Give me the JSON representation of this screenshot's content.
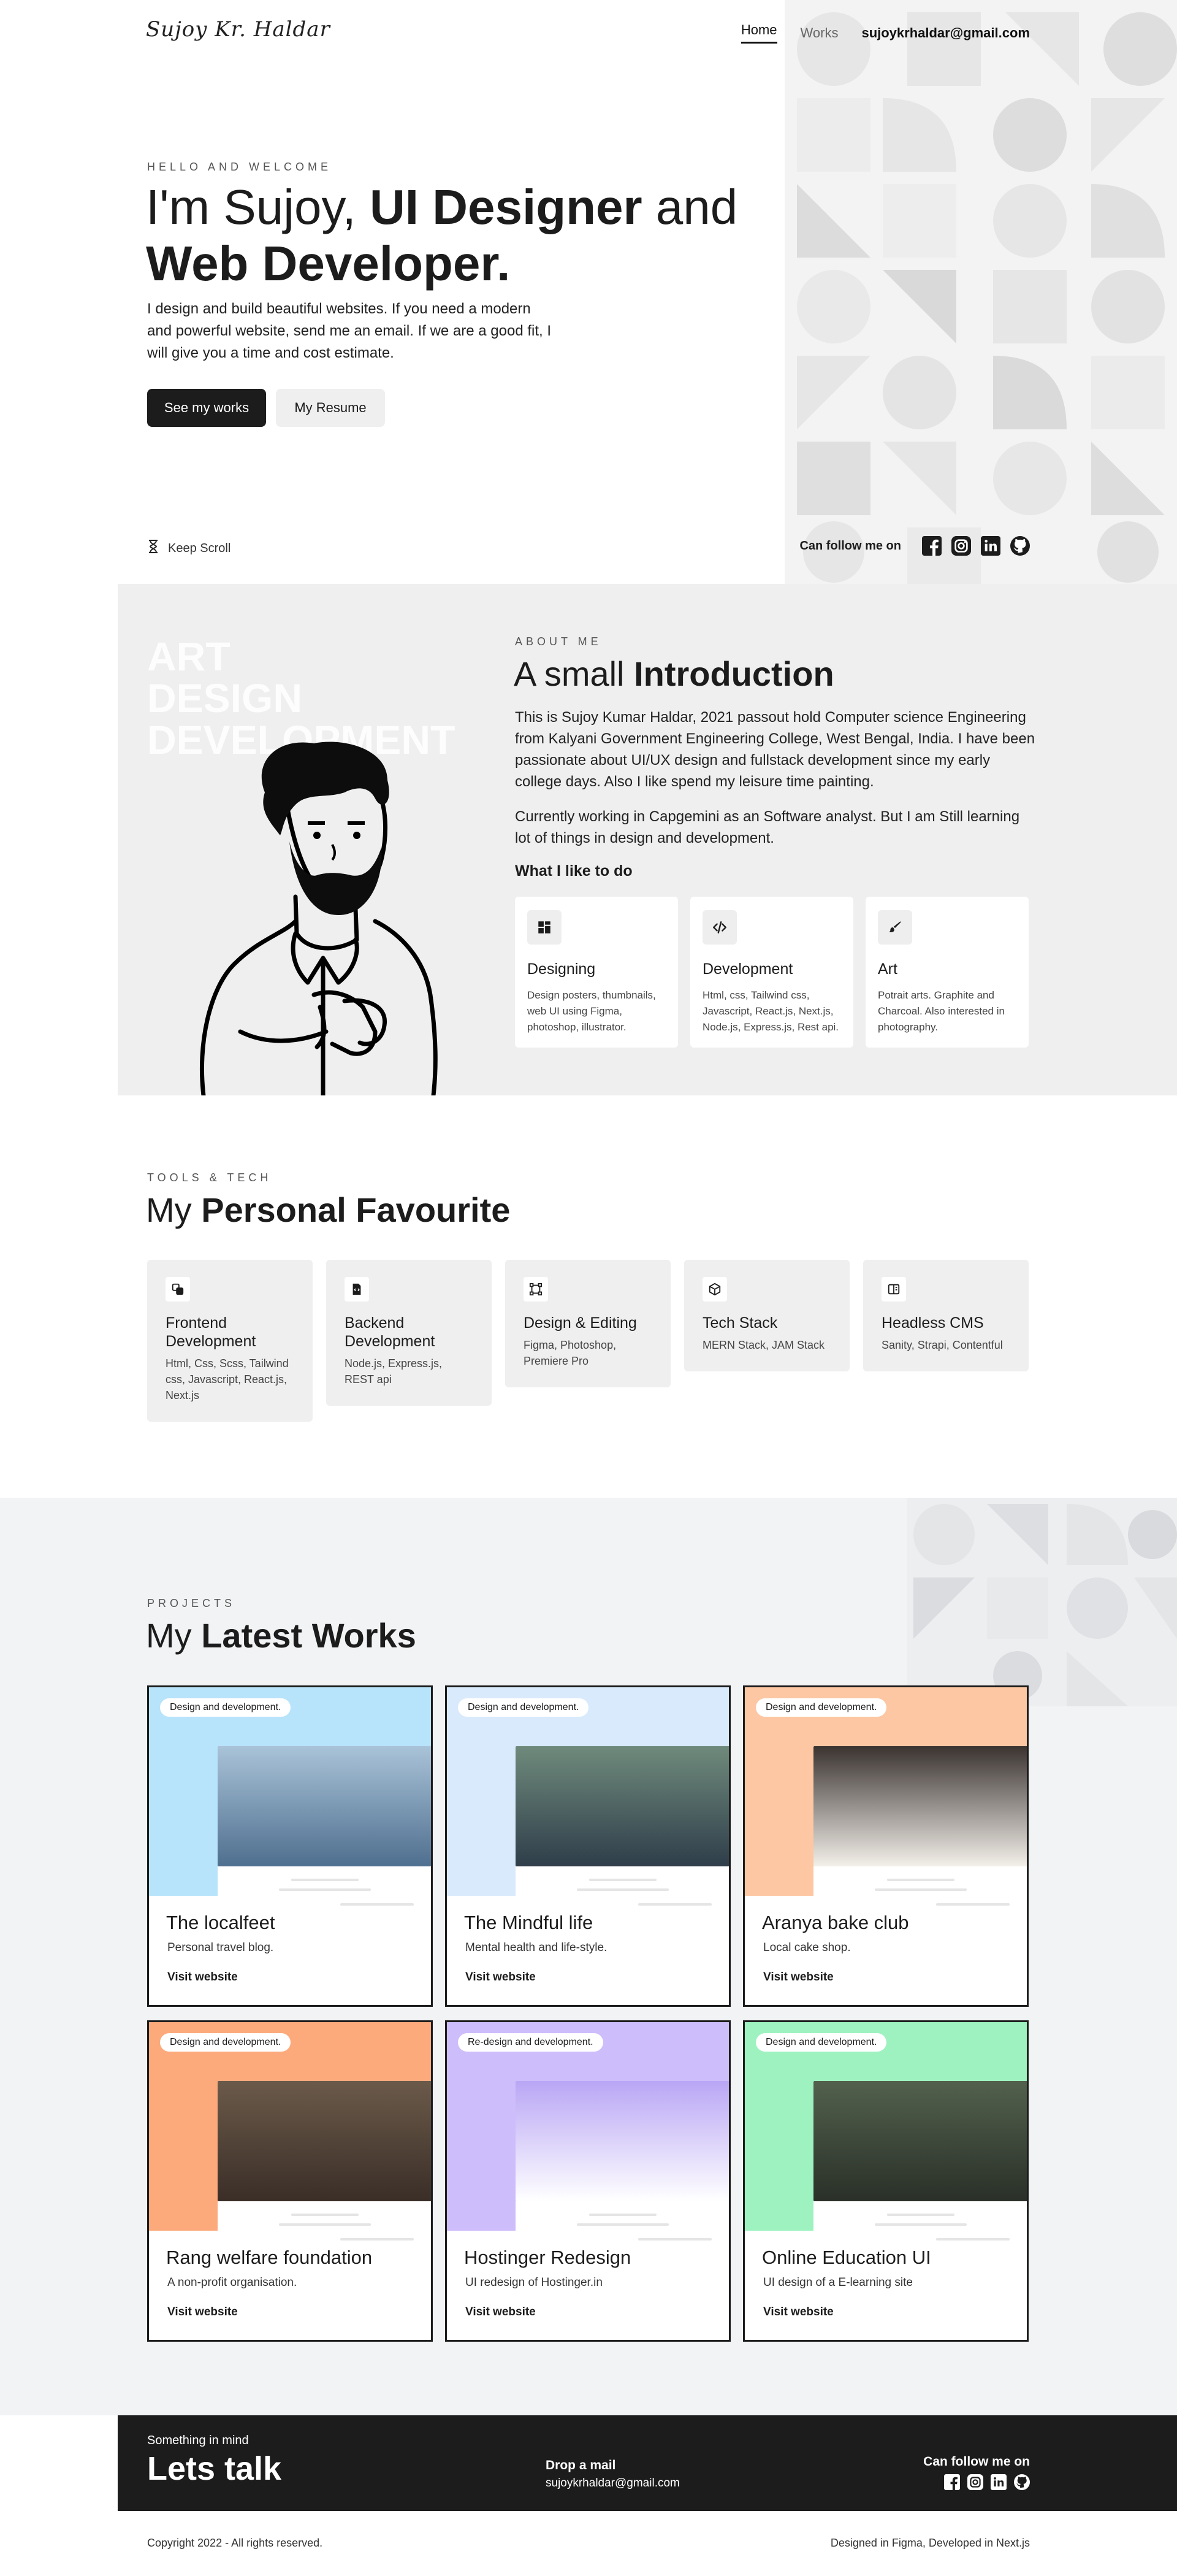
{
  "header": {
    "logo": "Sujoy Kr. Haldar",
    "nav": [
      {
        "label": "Home",
        "active": true
      },
      {
        "label": "Works",
        "active": false
      }
    ],
    "email": "sujoykrhaldar@gmail.com"
  },
  "hero": {
    "eyebrow": "HELLO AND WELCOME",
    "title_pre": "I'm Sujoy, ",
    "title_bold1": "UI Designer",
    "title_mid": " and",
    "title_bold2": "Web Developer.",
    "description": "I design and build beautiful websites. If you need a modern and powerful website, send me an email. If we are a good fit, I will give you a time and cost estimate.",
    "primary_button": "See my works",
    "secondary_button": "My Resume",
    "scroll_hint": "Keep Scroll",
    "follow_label": "Can follow me on"
  },
  "social_icons": [
    "facebook-icon",
    "instagram-icon",
    "linkedin-icon",
    "github-icon"
  ],
  "about": {
    "bg_words": [
      "ART",
      "DESIGN",
      "DEVELOPMENT"
    ],
    "eyebrow": "ABOUT ME",
    "title_pre": "A small ",
    "title_bold": "Introduction",
    "paragraph1": "This is Sujoy Kumar Haldar, 2021 passout hold Computer science Engineering from Kalyani Government Engineering College, West Bengal, India. I have been passionate about UI/UX design and fullstack development since my early college days. Also I like spend my leisure time painting.",
    "paragraph2": "Currently working in Capgemini as an Software analyst. But I am Still learning lot of things in design and development.",
    "likes_title": "What I like to do",
    "likes": [
      {
        "icon": "layout-icon",
        "title": "Designing",
        "text": "Design posters, thumbnails, web UI using Figma, photoshop, illustrator."
      },
      {
        "icon": "code-icon",
        "title": "Development",
        "text": "Html, css, Tailwind css, Javascript, React.js, Next.js, Node.js, Express.js, Rest api."
      },
      {
        "icon": "brush-icon",
        "title": "Art",
        "text": "Potrait arts. Graphite and Charcoal. Also interested in photography."
      }
    ]
  },
  "tools": {
    "eyebrow": "TOOLS & TECH",
    "title_pre": "My ",
    "title_bold": "Personal Favourite",
    "cards": [
      {
        "icon": "layers-icon",
        "title": "Frontend Development",
        "text": "Html, Css, Scss, Tailwind css, Javascript, React.js, Next.js"
      },
      {
        "icon": "file-code-icon",
        "title": "Backend Development",
        "text": "Node.js, Express.js, REST api"
      },
      {
        "icon": "vector-icon",
        "title": "Design & Editing",
        "text": "Figma, Photoshop, Premiere Pro"
      },
      {
        "icon": "box-icon",
        "title": "Tech Stack",
        "text": "MERN Stack, JAM Stack"
      },
      {
        "icon": "panel-icon",
        "title": "Headless CMS",
        "text": "Sanity, Strapi, Contentful"
      }
    ]
  },
  "projects": {
    "eyebrow": "PROJECTS",
    "title_pre": "My ",
    "title_bold": "Latest Works",
    "visit_label": "Visit website",
    "items": [
      {
        "tag": "Design and development.",
        "name": "The localfeet",
        "desc": "Personal travel blog.",
        "color": "#b7e3fb",
        "shot_a": "#4f6f8f",
        "shot_b": "#a9c3d8"
      },
      {
        "tag": "Design and development.",
        "name": "The Mindful life",
        "desc": "Mental health and life-style.",
        "color": "#d8eafb",
        "shot_a": "#2f3e4a",
        "shot_b": "#6f8a7c"
      },
      {
        "tag": "Design and development.",
        "name": "Aranya bake club",
        "desc": "Local cake shop.",
        "color": "#fdc7a3",
        "shot_a": "#f3efe9",
        "shot_b": "#3a3330"
      },
      {
        "tag": "Design and development.",
        "name": "Rang welfare foundation",
        "desc": "A non-profit organisation.",
        "color": "#fca97c",
        "shot_a": "#3a2e27",
        "shot_b": "#6b5a4a"
      },
      {
        "tag": "Re-design and development.",
        "name": "Hostinger Redesign",
        "desc": "UI redesign of Hostinger.in",
        "color": "#cdbdfb",
        "shot_a": "#ffffff",
        "shot_b": "#b9a6f5"
      },
      {
        "tag": "Design and development.",
        "name": "Online Education UI",
        "desc": "UI design of a E-learning site",
        "color": "#9df2c0",
        "shot_a": "#2a3028",
        "shot_b": "#52604d"
      }
    ]
  },
  "footer": {
    "small": "Something in mind",
    "big": "Lets talk",
    "drop_label": "Drop a mail",
    "email": "sujoykrhaldar@gmail.com",
    "follow_label": "Can follow me on",
    "copyright": "Copyright 2022 - All rights reserved.",
    "built_with": "Designed in Figma, Developed in Next.js"
  }
}
